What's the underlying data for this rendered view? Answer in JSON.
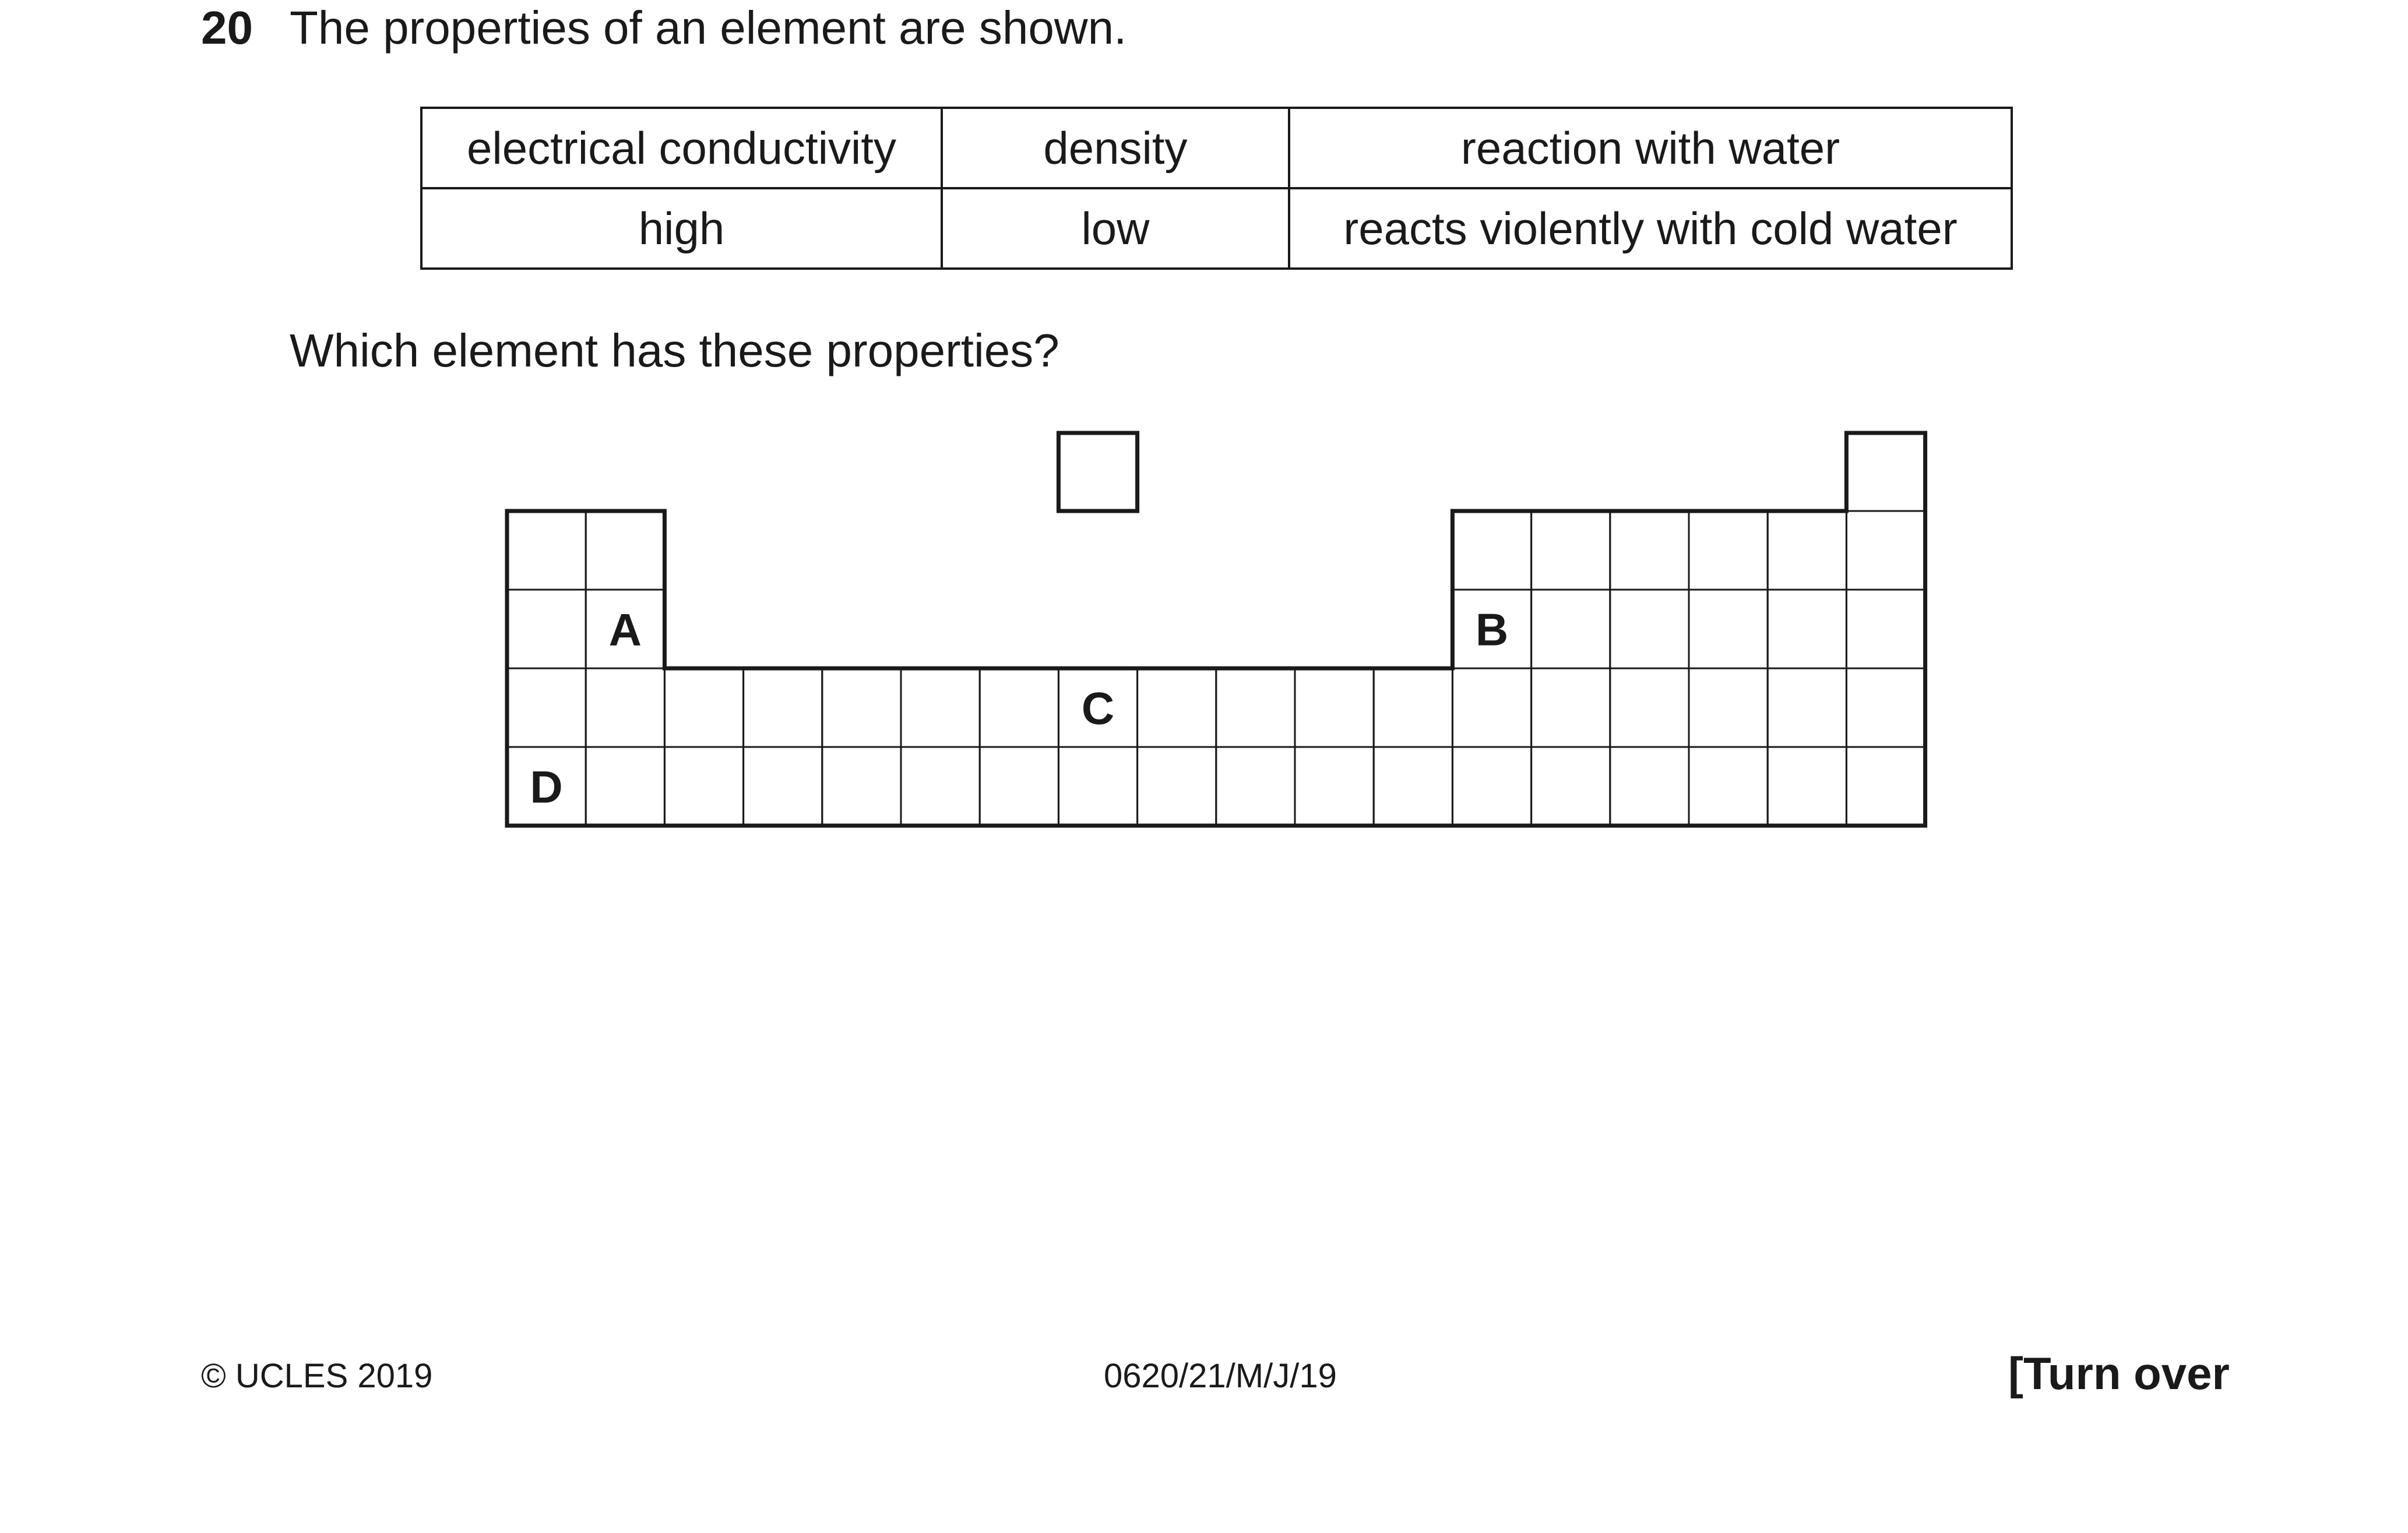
{
  "question": {
    "number": "20",
    "stem": "The properties of an element are shown.",
    "prompt": "Which element has these properties?"
  },
  "properties_table": {
    "headers": [
      "electrical conductivity",
      "density",
      "reaction with water"
    ],
    "values": [
      "high",
      "low",
      "reacts violently with cold water"
    ]
  },
  "periodic_table": {
    "labels": {
      "A": "A",
      "B": "B",
      "C": "C",
      "D": "D"
    }
  },
  "footer": {
    "copyright": "© UCLES 2019",
    "paper_code": "0620/21/M/J/19",
    "turn_over": "[Turn over"
  }
}
